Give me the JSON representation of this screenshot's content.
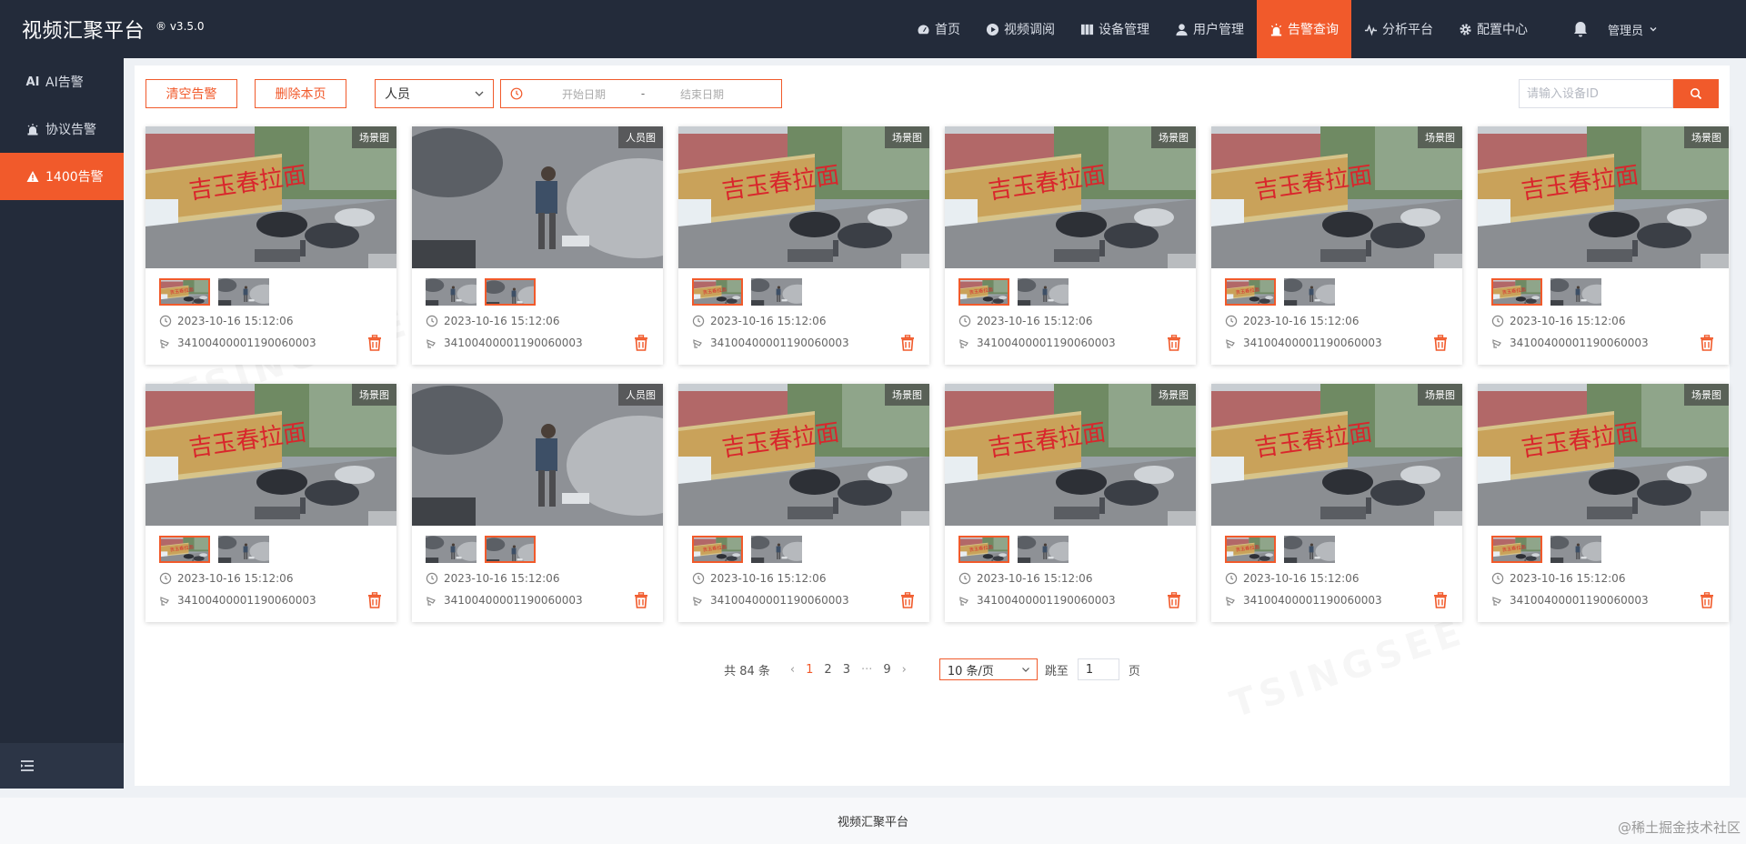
{
  "header": {
    "title": "视频汇聚平台",
    "version": "® v3.5.0",
    "nav": [
      {
        "label": "首页",
        "icon": "dashboard-icon"
      },
      {
        "label": "视频调阅",
        "icon": "play-circle-icon"
      },
      {
        "label": "设备管理",
        "icon": "device-icon"
      },
      {
        "label": "用户管理",
        "icon": "user-icon"
      },
      {
        "label": "告警查询",
        "icon": "alarm-icon",
        "active": true
      },
      {
        "label": "分析平台",
        "icon": "pulse-icon"
      },
      {
        "label": "配置中心",
        "icon": "gear-icon"
      }
    ],
    "user": "管理员"
  },
  "sidebar": {
    "items": [
      {
        "label": "AI告警",
        "icon": "ai-icon"
      },
      {
        "label": "协议告警",
        "icon": "siren-icon"
      },
      {
        "label": "1400告警",
        "icon": "warning-icon",
        "active": true
      }
    ]
  },
  "toolbar": {
    "clear_label": "清空告警",
    "delete_label": "删除本页",
    "type_value": "人员",
    "start_placeholder": "开始日期",
    "range_sep": "-",
    "end_placeholder": "结束日期",
    "search_placeholder": "请输入设备ID"
  },
  "cards": [
    {
      "badge": "场景图",
      "scene": "scene",
      "time": "2023-10-16  15:12:06",
      "device": "34100400001190060003"
    },
    {
      "badge": "人员图",
      "scene": "person",
      "time": "2023-10-16  15:12:06",
      "device": "34100400001190060003"
    },
    {
      "badge": "场景图",
      "scene": "scene",
      "time": "2023-10-16  15:12:06",
      "device": "34100400001190060003"
    },
    {
      "badge": "场景图",
      "scene": "scene",
      "time": "2023-10-16  15:12:06",
      "device": "34100400001190060003"
    },
    {
      "badge": "场景图",
      "scene": "scene",
      "time": "2023-10-16  15:12:06",
      "device": "34100400001190060003"
    },
    {
      "badge": "场景图",
      "scene": "scene",
      "time": "2023-10-16  15:12:06",
      "device": "34100400001190060003"
    },
    {
      "badge": "场景图",
      "scene": "scene",
      "time": "2023-10-16  15:12:06",
      "device": "34100400001190060003"
    },
    {
      "badge": "人员图",
      "scene": "person",
      "time": "2023-10-16  15:12:06",
      "device": "34100400001190060003"
    },
    {
      "badge": "场景图",
      "scene": "scene",
      "time": "2023-10-16  15:12:06",
      "device": "34100400001190060003"
    },
    {
      "badge": "场景图",
      "scene": "scene",
      "time": "2023-10-16  15:12:06",
      "device": "34100400001190060003"
    },
    {
      "badge": "场景图",
      "scene": "scene",
      "time": "2023-10-16  15:12:06",
      "device": "34100400001190060003"
    },
    {
      "badge": "场景图",
      "scene": "scene",
      "time": "2023-10-16  15:12:06",
      "device": "34100400001190060003"
    }
  ],
  "pagination": {
    "total": "共 84 条",
    "pages": [
      "1",
      "2",
      "3",
      "···",
      "9"
    ],
    "current": "1",
    "page_size": "10 条/页",
    "jump_label": "跳至",
    "jump_value": "1",
    "page_suffix": "页"
  },
  "footer": {
    "text": "视频汇聚平台",
    "watermark": "@稀土掘金技术社区"
  },
  "colors": {
    "accent": "#f15a2b",
    "header_bg": "#232b3a"
  }
}
